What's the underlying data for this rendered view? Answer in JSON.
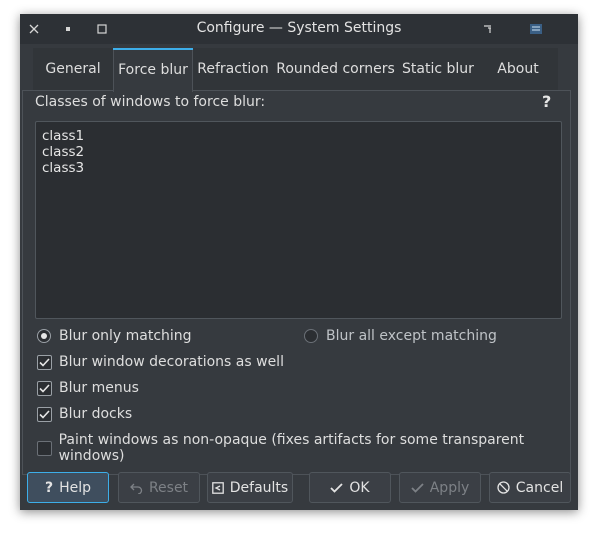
{
  "window": {
    "title": "Configure — System Settings"
  },
  "titlebar": {
    "close_icon": "close-icon",
    "minimize_icon": "minimize-icon",
    "maximize_icon": "maximize-icon"
  },
  "tabs": [
    {
      "label": "General"
    },
    {
      "label": "Force blur"
    },
    {
      "label": "Refraction"
    },
    {
      "label": "Rounded corners"
    },
    {
      "label": "Static blur"
    },
    {
      "label": "About"
    }
  ],
  "active_tab": "Force blur",
  "force_blur": {
    "classes_label": "Classes of windows to force blur:",
    "help_glyph": "?",
    "classes": [
      "class1",
      "class2",
      "class3"
    ],
    "radio_only": "Blur only matching",
    "radio_all_except": "Blur all except matching",
    "selected_radio": "Blur only matching",
    "check_decorations": "Blur window decorations as well",
    "check_menus": "Blur menus",
    "check_docks": "Blur docks",
    "check_non_opaque": "Paint windows as non-opaque (fixes artifacts for some transparent windows)",
    "checked": {
      "decorations": true,
      "menus": true,
      "docks": true,
      "non_opaque": false
    }
  },
  "footer": {
    "help": "Help",
    "reset": "Reset",
    "defaults": "Defaults",
    "ok": "OK",
    "apply": "Apply",
    "cancel": "Cancel"
  },
  "colors": {
    "accent": "#3daee9",
    "window_bg": "#363a3f",
    "titlebar_bg": "#2d3136"
  }
}
